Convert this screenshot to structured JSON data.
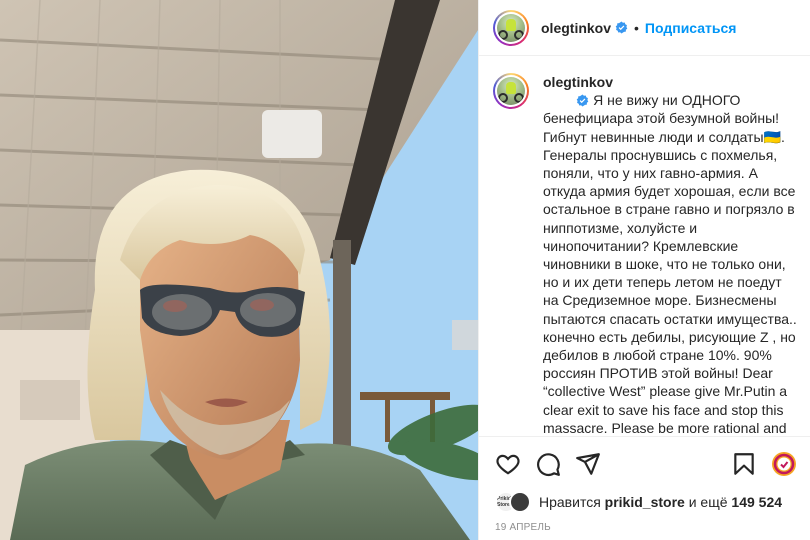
{
  "post": {
    "username": "olegtinkov",
    "follow_label": "Подписаться",
    "separator": "•",
    "caption": "Я не вижу ни ОДНОГО бенефициара этой безумной войны! Гибнут невинные люди и солдаты🇺🇦. Генералы проснувшись с похмелья, поняли, что у них гавно-армия. А откуда армия будет хорошая, если все остальное в стране гавно и погрязло в ниппотизме, холуйсте и чинопочитании? Кремлевские чиновники в шоке, что не только они, но и их дети теперь летом не поедут на Средиземное море. Бизнесмены пытаются спасать остатки имущества.. конечно есть дебилы, рисующие Z , но дебилов в любой стране 10%. 90% россиян ПРОТИВ этой войны! Dear “collective West” please give Mr.Putin a clear exit to save his face and stop this massacre. Please be more rational and humanitarian ❤️",
    "likes_prefix": "Нравится",
    "likes_user": "prikid_store",
    "likes_middle": "и ещё",
    "likes_count": "149 524",
    "liker_avatar_text": "Prikid Store",
    "date": "19 АПРЕЛЬ"
  },
  "icons": {
    "verified": "verified-badge-icon",
    "like": "heart-icon",
    "comment": "comment-icon",
    "share": "paper-plane-icon",
    "save": "bookmark-icon",
    "reels": "circular-arrow-icon"
  },
  "colors": {
    "accent": "#0095f6",
    "verified": "#3897f0",
    "text": "#262626",
    "muted": "#8e8e8e"
  }
}
